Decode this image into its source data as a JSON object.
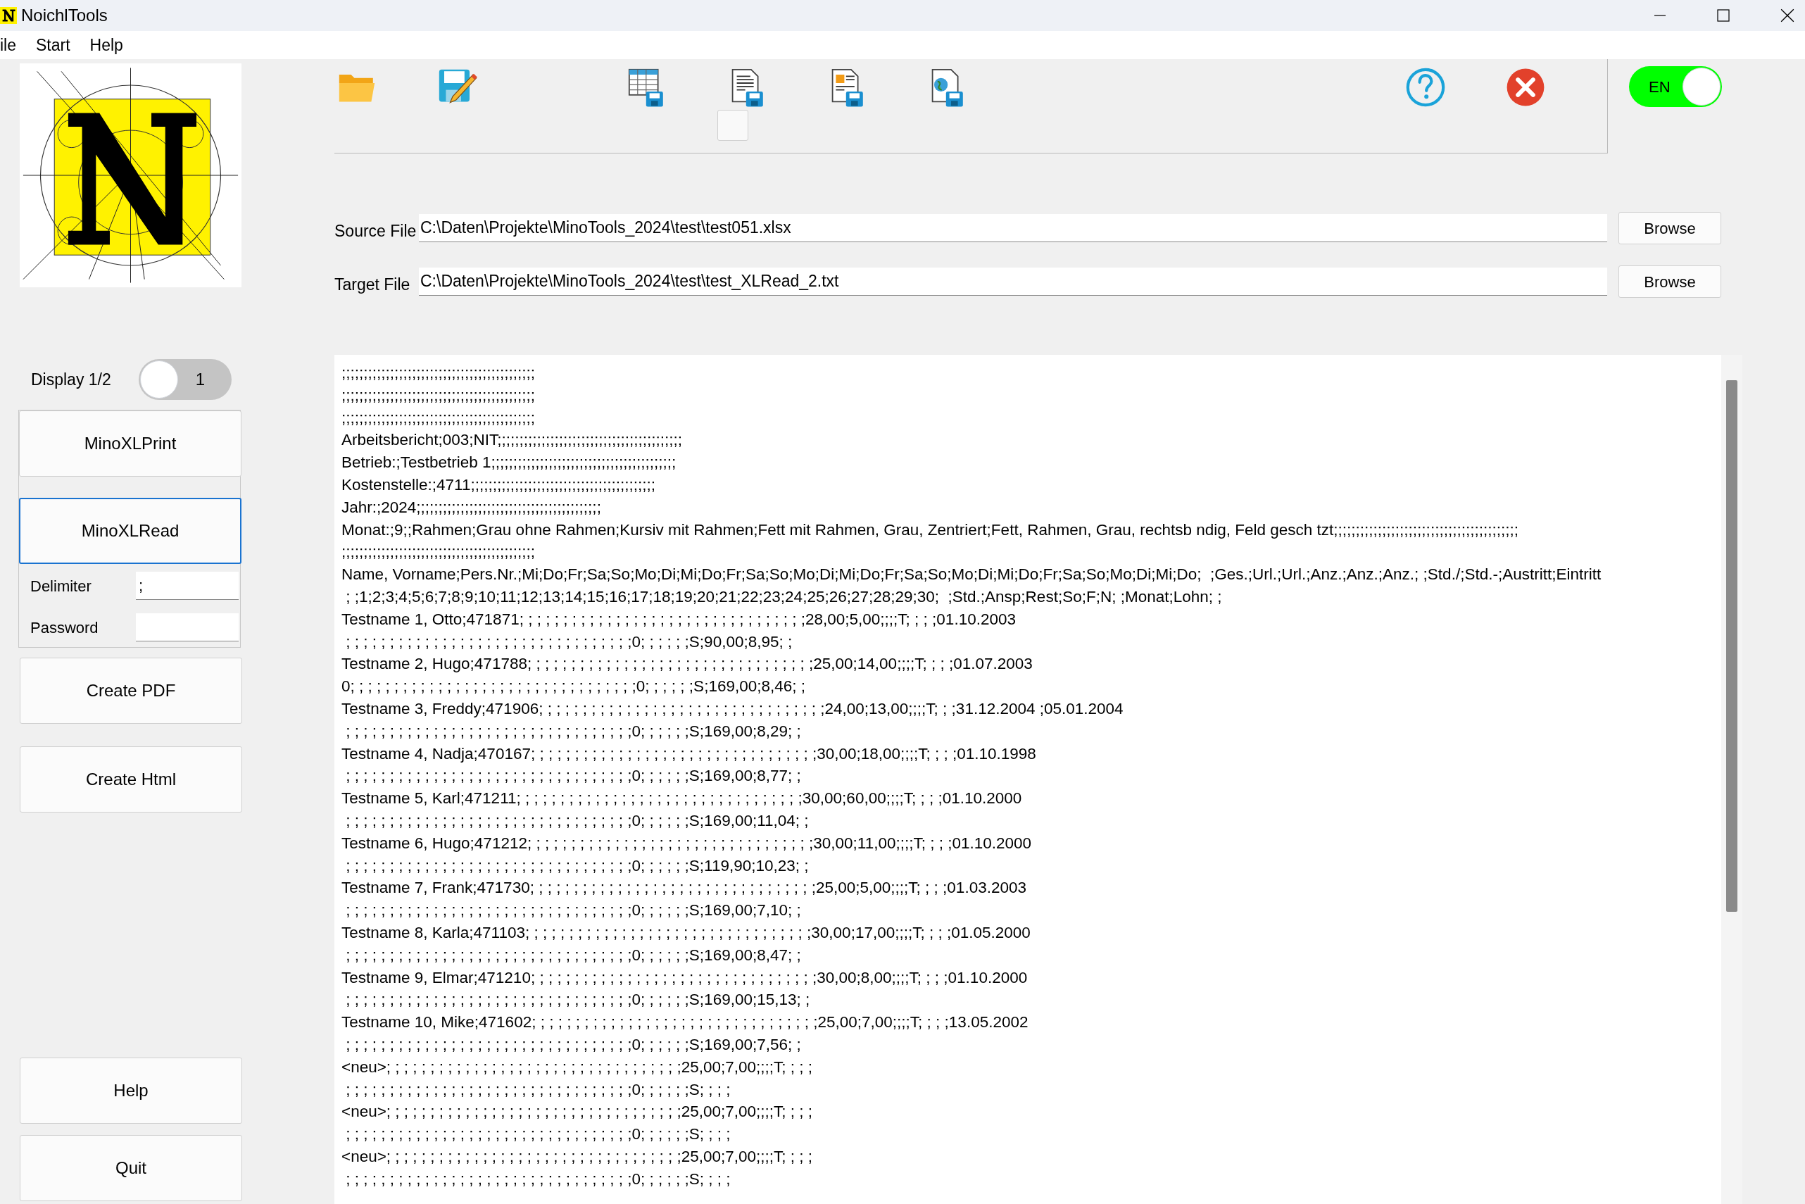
{
  "window": {
    "title": "NoichlTools"
  },
  "menu": [
    "ile",
    "Start",
    "Help"
  ],
  "toolbar": {
    "buttons": [
      {
        "kind": "folder"
      },
      {
        "kind": "save"
      },
      {
        "kind": "table"
      },
      {
        "kind": "document"
      },
      {
        "kind": "layout"
      },
      {
        "kind": "web"
      },
      {
        "kind": "help"
      },
      {
        "kind": "close"
      }
    ],
    "checkbox": {
      "checked": false
    }
  },
  "language_toggle": {
    "label": "EN",
    "on": true
  },
  "source_file": {
    "label": "Source File",
    "value": "C:\\Daten\\Projekte\\MinoTools_2024\\test\\test051.xlsx",
    "button": "Browse"
  },
  "target_file": {
    "label": "Target File",
    "value": "C:\\Daten\\Projekte\\MinoTools_2024\\test\\test_XLRead_2.txt",
    "button": "Browse"
  },
  "display_toggle": {
    "label": "Display 1/2",
    "value": "1",
    "on": false
  },
  "sidebar": {
    "buttons": [
      {
        "label": "MinoXLPrint",
        "selected": false
      },
      {
        "label": "MinoXLRead",
        "selected": true
      }
    ],
    "delimiter": {
      "label": "Delimiter",
      "value": ";"
    },
    "password": {
      "label": "Password"
    },
    "actions": [
      "Create PDF",
      "Create Html"
    ],
    "bottom_buttons": [
      "Help",
      "Quit"
    ]
  },
  "output_lines": [
    ";;;;;;;;;;;;;;;;;;;;;;;;;;;;;;;;;;;;;;;;;;;;",
    ";;;;;;;;;;;;;;;;;;;;;;;;;;;;;;;;;;;;;;;;;;;;",
    ";;;;;;;;;;;;;;;;;;;;;;;;;;;;;;;;;;;;;;;;;;;;",
    "Arbeitsbericht;003;NIT;;;;;;;;;;;;;;;;;;;;;;;;;;;;;;;;;;;;;;;;;;",
    "Betrieb:;Testbetrieb 1;;;;;;;;;;;;;;;;;;;;;;;;;;;;;;;;;;;;;;;;;;",
    "Kostenstelle:;4711;;;;;;;;;;;;;;;;;;;;;;;;;;;;;;;;;;;;;;;;;;",
    "Jahr:;2024;;;;;;;;;;;;;;;;;;;;;;;;;;;;;;;;;;;;;;;;;;",
    "Monat:;9;;Rahmen;Grau ohne Rahmen;Kursiv mit Rahmen;Fett mit Rahmen, Grau, Zentriert;Fett, Rahmen, Grau, rechtsb ndig, Feld gesch tzt;;;;;;;;;;;;;;;;;;;;;;;;;;;;;;;;;;;;;;;;;;",
    ";;;;;;;;;;;;;;;;;;;;;;;;;;;;;;;;;;;;;;;;;;;;",
    "Name, Vorname;Pers.Nr.;Mi;Do;Fr;Sa;So;Mo;Di;Mi;Do;Fr;Sa;So;Mo;Di;Mi;Do;Fr;Sa;So;Mo;Di;Mi;Do;Fr;Sa;So;Mo;Di;Mi;Do;  ;Ges.;Url.;Url.;Anz.;Anz.;Anz.; ;Std./;Std.-;Austritt;Eintritt",
    " ; ;1;2;3;4;5;6;7;8;9;10;11;12;13;14;15;16;17;18;19;20;21;22;23;24;25;26;27;28;29;30;  ;Std.;Ansp;Rest;So;F;N; ;Monat;Lohn; ;",
    "Testname 1, Otto;471871; ; ; ; ; ; ; ; ; ; ; ; ; ; ; ; ; ; ; ; ; ; ; ; ; ; ; ; ; ; ; ; ;28,00;5,00;;;;T; ; ; ;01.10.2003",
    " ; ; ; ; ; ; ; ; ; ; ; ; ; ; ; ; ; ; ; ; ; ; ; ; ; ; ; ; ; ; ; ; ;0; ; ; ; ; ;S;90,00;8,95; ;",
    "Testname 2, Hugo;471788; ; ; ; ; ; ; ; ; ; ; ; ; ; ; ; ; ; ; ; ; ; ; ; ; ; ; ; ; ; ; ; ;25,00;14,00;;;;T; ; ; ;01.07.2003",
    "0; ; ; ; ; ; ; ; ; ; ; ; ; ; ; ; ; ; ; ; ; ; ; ; ; ; ; ; ; ; ; ; ;0; ; ; ; ; ;S;169,00;8,46; ;",
    "Testname 3, Freddy;471906; ; ; ; ; ; ; ; ; ; ; ; ; ; ; ; ; ; ; ; ; ; ; ; ; ; ; ; ; ; ; ; ;24,00;13,00;;;;T; ; ;31.12.2004 ;05.01.2004",
    " ; ; ; ; ; ; ; ; ; ; ; ; ; ; ; ; ; ; ; ; ; ; ; ; ; ; ; ; ; ; ; ; ;0; ; ; ; ; ;S;169,00;8,29; ;",
    "Testname 4, Nadja;470167; ; ; ; ; ; ; ; ; ; ; ; ; ; ; ; ; ; ; ; ; ; ; ; ; ; ; ; ; ; ; ; ;30,00;18,00;;;;T; ; ; ;01.10.1998",
    " ; ; ; ; ; ; ; ; ; ; ; ; ; ; ; ; ; ; ; ; ; ; ; ; ; ; ; ; ; ; ; ; ;0; ; ; ; ; ;S;169,00;8,77; ;",
    "Testname 5, Karl;471211; ; ; ; ; ; ; ; ; ; ; ; ; ; ; ; ; ; ; ; ; ; ; ; ; ; ; ; ; ; ; ; ;30,00;60,00;;;;T; ; ; ;01.10.2000",
    " ; ; ; ; ; ; ; ; ; ; ; ; ; ; ; ; ; ; ; ; ; ; ; ; ; ; ; ; ; ; ; ; ;0; ; ; ; ; ;S;169,00;11,04; ;",
    "Testname 6, Hugo;471212; ; ; ; ; ; ; ; ; ; ; ; ; ; ; ; ; ; ; ; ; ; ; ; ; ; ; ; ; ; ; ; ;30,00;11,00;;;;T; ; ; ;01.10.2000",
    " ; ; ; ; ; ; ; ; ; ; ; ; ; ; ; ; ; ; ; ; ; ; ; ; ; ; ; ; ; ; ; ; ;0; ; ; ; ; ;S;119,90;10,23; ;",
    "Testname 7, Frank;471730; ; ; ; ; ; ; ; ; ; ; ; ; ; ; ; ; ; ; ; ; ; ; ; ; ; ; ; ; ; ; ; ;25,00;5,00;;;;T; ; ; ;01.03.2003",
    " ; ; ; ; ; ; ; ; ; ; ; ; ; ; ; ; ; ; ; ; ; ; ; ; ; ; ; ; ; ; ; ; ;0; ; ; ; ; ;S;169,00;7,10; ;",
    "Testname 8, Karla;471103; ; ; ; ; ; ; ; ; ; ; ; ; ; ; ; ; ; ; ; ; ; ; ; ; ; ; ; ; ; ; ; ;30,00;17,00;;;;T; ; ; ;01.05.2000",
    " ; ; ; ; ; ; ; ; ; ; ; ; ; ; ; ; ; ; ; ; ; ; ; ; ; ; ; ; ; ; ; ; ;0; ; ; ; ; ;S;169,00;8,47; ;",
    "Testname 9, Elmar;471210; ; ; ; ; ; ; ; ; ; ; ; ; ; ; ; ; ; ; ; ; ; ; ; ; ; ; ; ; ; ; ; ;30,00;8,00;;;;T; ; ; ;01.10.2000",
    " ; ; ; ; ; ; ; ; ; ; ; ; ; ; ; ; ; ; ; ; ; ; ; ; ; ; ; ; ; ; ; ; ;0; ; ; ; ; ;S;169,00;15,13; ;",
    "Testname 10, Mike;471602; ; ; ; ; ; ; ; ; ; ; ; ; ; ; ; ; ; ; ; ; ; ; ; ; ; ; ; ; ; ; ; ;25,00;7,00;;;;T; ; ; ;13.05.2002",
    " ; ; ; ; ; ; ; ; ; ; ; ; ; ; ; ; ; ; ; ; ; ; ; ; ; ; ; ; ; ; ; ; ;0; ; ; ; ; ;S;169,00;7,56; ;",
    "<neu>; ; ; ; ; ; ; ; ; ; ; ; ; ; ; ; ; ; ; ; ; ; ; ; ; ; ; ; ; ; ; ; ; ;25,00;7,00;;;;T; ; ; ;",
    " ; ; ; ; ; ; ; ; ; ; ; ; ; ; ; ; ; ; ; ; ; ; ; ; ; ; ; ; ; ; ; ; ;0; ; ; ; ; ;S; ; ; ;",
    "<neu>; ; ; ; ; ; ; ; ; ; ; ; ; ; ; ; ; ; ; ; ; ; ; ; ; ; ; ; ; ; ; ; ; ;25,00;7,00;;;;T; ; ; ;",
    " ; ; ; ; ; ; ; ; ; ; ; ; ; ; ; ; ; ; ; ; ; ; ; ; ; ; ; ; ; ; ; ; ;0; ; ; ; ; ;S; ; ; ;",
    "<neu>; ; ; ; ; ; ; ; ; ; ; ; ; ; ; ; ; ; ; ; ; ; ; ; ; ; ; ; ; ; ; ; ; ;25,00;7,00;;;;T; ; ; ;",
    " ; ; ; ; ; ; ; ; ; ; ; ; ; ; ; ; ; ; ; ; ; ; ; ; ; ; ; ; ; ; ; ; ;0; ; ; ; ; ;S; ; ; ;"
  ]
}
